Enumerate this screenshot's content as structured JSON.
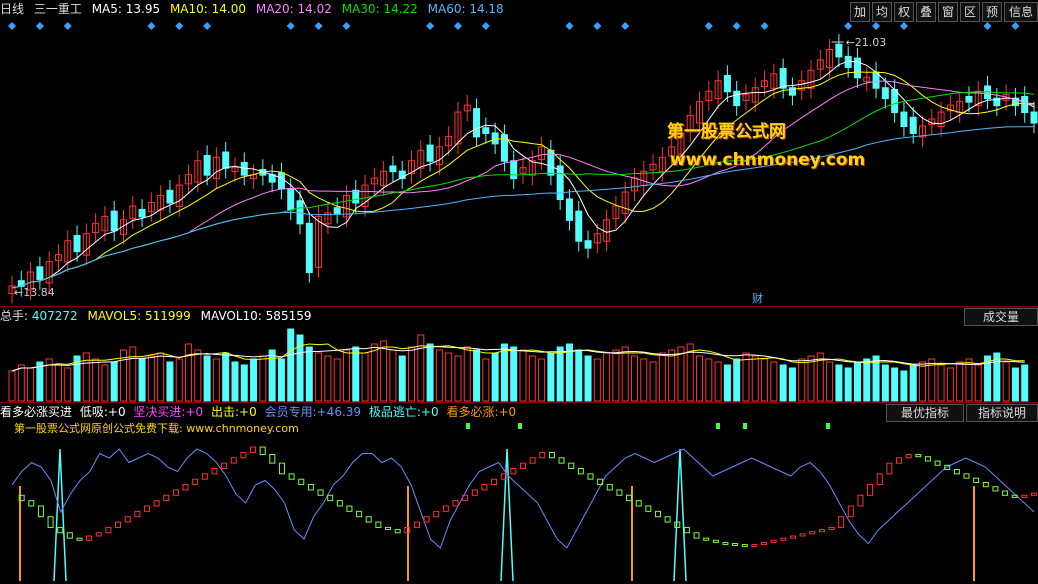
{
  "colors": {
    "up": "#ff3232",
    "down": "#54fcfc",
    "ma5": "#ffffff",
    "ma10": "#ffff00",
    "ma20": "#ff80ff",
    "ma30": "#00e000",
    "ma60": "#4fb8ff",
    "diamond": "#3aa0ff",
    "green_step": "#7cff40",
    "red_step": "#ff3030",
    "blue_line": "#6b8cff",
    "orange_bar": "#ff9900",
    "cyan_spike": "#54fcfc"
  },
  "main": {
    "period_label": "日线",
    "stock_name": "三一重工",
    "ma5_label": "MA5:",
    "ma5_value": "13.95",
    "ma10_label": "MA10:",
    "ma10_value": "14.00",
    "ma20_label": "MA20:",
    "ma20_value": "14.02",
    "ma30_label": "MA30:",
    "ma30_value": "14.22",
    "ma60_label": "MA60:",
    "ma60_value": "14.18",
    "high_label": "21.03",
    "low_label": "13.84",
    "fin_marker": "财",
    "toolbar": [
      "加",
      "均",
      "权",
      "叠",
      "窗",
      "区",
      "预",
      "信息"
    ]
  },
  "watermark": {
    "title": "第一股票公式网",
    "url": "www.chnmoney.com",
    "line": "第一股票公式网原创公式免费下载: www.chnmoney.com"
  },
  "volume": {
    "total_label": "总手:",
    "total_value": "407272",
    "mavol5_label": "MAVOL5:",
    "mavol5_value": "511999",
    "mavol10_label": "MAVOL10:",
    "mavol10_value": "585159",
    "button": "成交量"
  },
  "indicator": {
    "name": "看多必涨买进",
    "items": [
      {
        "label": "低吸:",
        "value": "+0",
        "color": "#ffffff"
      },
      {
        "label": "坚决买进:",
        "value": "+0",
        "color": "#ff40ff"
      },
      {
        "label": "出击:",
        "value": "+0",
        "color": "#ffff00"
      },
      {
        "label": "会员专用:",
        "value": "+46.39",
        "color": "#6b8cff"
      },
      {
        "label": "极品逃亡:",
        "value": "+0",
        "color": "#54fcfc"
      },
      {
        "label": "看多必涨:",
        "value": "+0",
        "color": "#ff9900"
      }
    ],
    "btn_best": "最优指标",
    "btn_help": "指标说明"
  },
  "chart_data": {
    "type": "candlestick",
    "y_price_range": [
      13.84,
      21.03
    ],
    "marked_high": 21.03,
    "marked_low": 13.84,
    "ma_legend": {
      "MA5": 13.95,
      "MA10": 14.0,
      "MA20": 14.02,
      "MA30": 14.22,
      "MA60": 14.18
    },
    "price": [
      13.9,
      14.0,
      14.3,
      14.2,
      14.6,
      14.8,
      15.2,
      15.0,
      15.4,
      15.7,
      15.9,
      15.6,
      15.8,
      16.2,
      16.0,
      16.3,
      16.5,
      16.4,
      16.8,
      17.1,
      17.5,
      17.2,
      17.6,
      17.4,
      17.3,
      17.2,
      17.1,
      17.2,
      17.0,
      16.8,
      16.2,
      15.8,
      14.4,
      15.9,
      16.0,
      16.1,
      16.5,
      16.4,
      16.8,
      17.0,
      17.2,
      17.3,
      17.1,
      17.5,
      17.8,
      17.6,
      17.9,
      18.2,
      18.9,
      19.1,
      18.3,
      18.4,
      18.1,
      17.6,
      17.1,
      17.3,
      17.5,
      17.9,
      17.2,
      16.5,
      15.9,
      15.3,
      15.1,
      15.4,
      15.8,
      16.2,
      16.6,
      17.0,
      17.2,
      17.4,
      17.6,
      17.9,
      18.3,
      18.8,
      19.2,
      19.5,
      19.8,
      19.6,
      19.2,
      19.4,
      19.6,
      19.8,
      20.0,
      19.7,
      19.5,
      19.8,
      20.1,
      20.4,
      20.7,
      20.6,
      20.3,
      20.0,
      19.9,
      19.7,
      19.4,
      19.0,
      18.6,
      18.4,
      18.5,
      18.7,
      18.9,
      19.1,
      19.2,
      19.3,
      19.5,
      19.4,
      19.2,
      19.4,
      19.2,
      19.0,
      18.7
    ],
    "volume": [
      50,
      60,
      55,
      65,
      70,
      60,
      55,
      75,
      80,
      70,
      60,
      65,
      85,
      90,
      70,
      75,
      80,
      65,
      70,
      95,
      85,
      75,
      70,
      80,
      65,
      60,
      70,
      75,
      85,
      70,
      120,
      110,
      90,
      80,
      75,
      70,
      85,
      90,
      80,
      95,
      100,
      85,
      75,
      90,
      110,
      95,
      85,
      80,
      75,
      90,
      85,
      70,
      80,
      95,
      90,
      85,
      75,
      70,
      80,
      90,
      95,
      85,
      75,
      70,
      80,
      85,
      90,
      75,
      70,
      65,
      80,
      85,
      90,
      95,
      75,
      70,
      65,
      60,
      70,
      80,
      75,
      70,
      65,
      60,
      55,
      70,
      75,
      80,
      65,
      60,
      55,
      65,
      70,
      75,
      60,
      55,
      50,
      60,
      65,
      70,
      60,
      55,
      65,
      70,
      60,
      75,
      80,
      65,
      55,
      60
    ],
    "blue_line": [
      60,
      45,
      35,
      40,
      55,
      90,
      70,
      55,
      45,
      25,
      30,
      20,
      35,
      30,
      25,
      30,
      40,
      45,
      30,
      20,
      25,
      35,
      50,
      70,
      80,
      60,
      55,
      65,
      80,
      110,
      120,
      95,
      80,
      60,
      50,
      35,
      25,
      25,
      35,
      30,
      40,
      60,
      90,
      120,
      130,
      100,
      80,
      60,
      45,
      40,
      35,
      50,
      60,
      70,
      80,
      100,
      120,
      130,
      110,
      90,
      70,
      50,
      40,
      30,
      25,
      30,
      35,
      30,
      25,
      20,
      30,
      40,
      50,
      45,
      40,
      35,
      30,
      35,
      40,
      45,
      50,
      40,
      35,
      45,
      60,
      80,
      100,
      115,
      125,
      110,
      100,
      90,
      80,
      70,
      60,
      50,
      40,
      35,
      30,
      35,
      40,
      50,
      60,
      70,
      80,
      90
    ],
    "step_line": [
      80,
      75,
      70,
      60,
      50,
      45,
      40,
      38,
      42,
      45,
      50,
      55,
      60,
      65,
      70,
      75,
      80,
      85,
      90,
      95,
      100,
      105,
      110,
      115,
      120,
      125,
      118,
      110,
      100,
      95,
      90,
      85,
      80,
      75,
      70,
      65,
      60,
      55,
      50,
      48,
      45,
      50,
      55,
      60,
      65,
      70,
      75,
      80,
      85,
      90,
      95,
      100,
      105,
      110,
      115,
      120,
      115,
      110,
      105,
      100,
      95,
      90,
      85,
      80,
      75,
      70,
      65,
      60,
      55,
      50,
      45,
      40,
      38,
      36,
      35,
      34,
      33,
      34,
      36,
      38,
      40,
      42,
      44,
      46,
      48,
      50,
      60,
      70,
      80,
      90,
      100,
      110,
      115,
      118,
      116,
      112,
      108,
      104,
      100,
      96,
      92,
      88,
      84,
      80,
      78,
      80,
      82
    ]
  }
}
